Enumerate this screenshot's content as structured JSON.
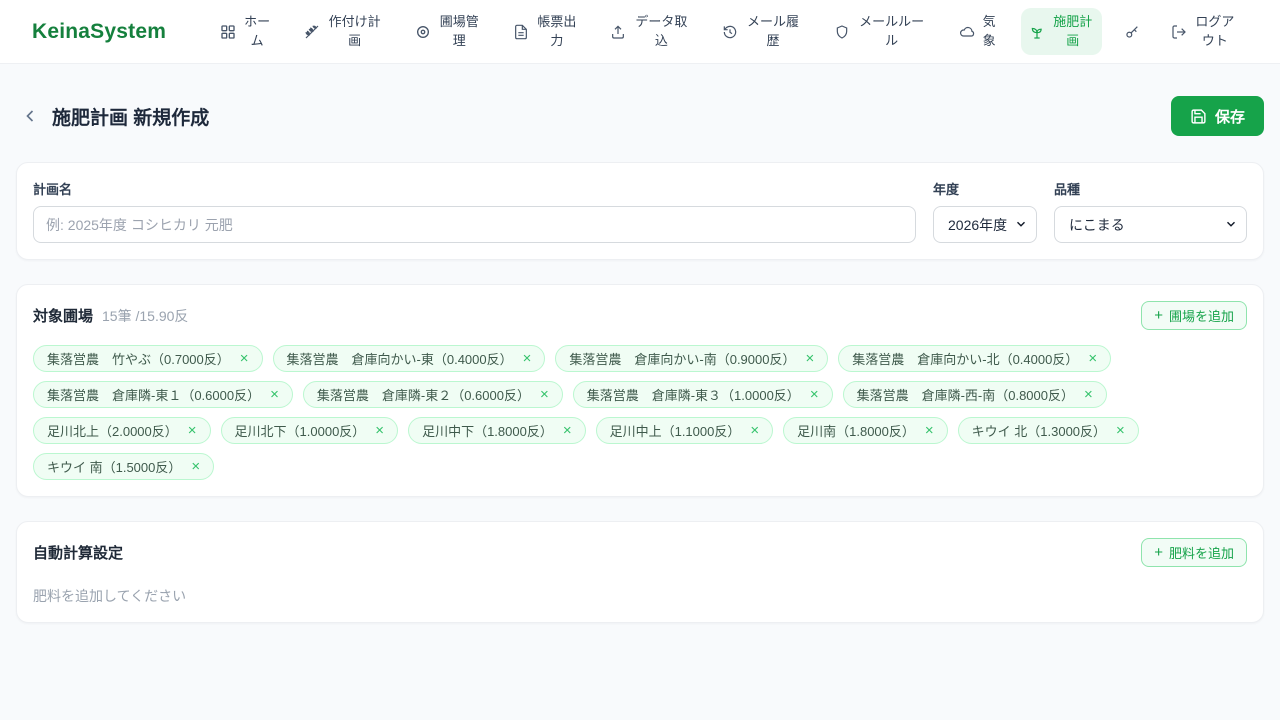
{
  "brand": "KeinaSystem",
  "colors": {
    "accent_green": "#16a34a",
    "logo_green": "#15803d",
    "active_nav_bg": "#e8f7ee",
    "chip_bg": "#f0fdf4",
    "chip_border": "#bbf7d0",
    "page_bg": "#f8fafc"
  },
  "icons": {
    "close": "×",
    "plus": "+"
  },
  "nav": {
    "items": [
      {
        "label": "ホーム",
        "icon": "grid"
      },
      {
        "label": "作付け計画",
        "icon": "wheat"
      },
      {
        "label": "圃場管理",
        "icon": "location"
      },
      {
        "label": "帳票出力",
        "icon": "document"
      },
      {
        "label": "データ取込",
        "icon": "upload"
      },
      {
        "label": "メール履歴",
        "icon": "history"
      },
      {
        "label": "メールルール",
        "icon": "shield"
      },
      {
        "label": "気象",
        "icon": "cloud"
      },
      {
        "label": "施肥計画",
        "icon": "sprout",
        "active": true
      }
    ],
    "logout": {
      "label": "ログアウト",
      "icon": "logout"
    }
  },
  "header": {
    "title": "施肥計画 新規作成",
    "save_label": "保存"
  },
  "form": {
    "plan_name": {
      "label": "計画名",
      "placeholder": "例: 2025年度 コシヒカリ 元肥",
      "value": ""
    },
    "year": {
      "label": "年度",
      "selected": "2026年度"
    },
    "variety": {
      "label": "品種",
      "selected": "にこまる"
    }
  },
  "fields": {
    "title": "対象圃場",
    "count_text": "15筆 /15.90反",
    "add_label": "圃場を追加",
    "chips": [
      "集落営農　竹やぶ（0.7000反）",
      "集落営農　倉庫向かい-東（0.4000反）",
      "集落営農　倉庫向かい-南（0.9000反）",
      "集落営農　倉庫向かい-北（0.4000反）",
      "集落営農　倉庫隣-東１（0.6000反）",
      "集落営農　倉庫隣-東２（0.6000反）",
      "集落営農　倉庫隣-東３（1.0000反）",
      "集落営農　倉庫隣-西-南（0.8000反）",
      "足川北上（2.0000反）",
      "足川北下（1.0000反）",
      "足川中下（1.8000反）",
      "足川中上（1.1000反）",
      "足川南（1.8000反）",
      "キウイ 北（1.3000反）",
      "キウイ 南（1.5000反）"
    ]
  },
  "auto_calc": {
    "title": "自動計算設定",
    "add_label": "肥料を追加",
    "empty_text": "肥料を追加してください"
  }
}
